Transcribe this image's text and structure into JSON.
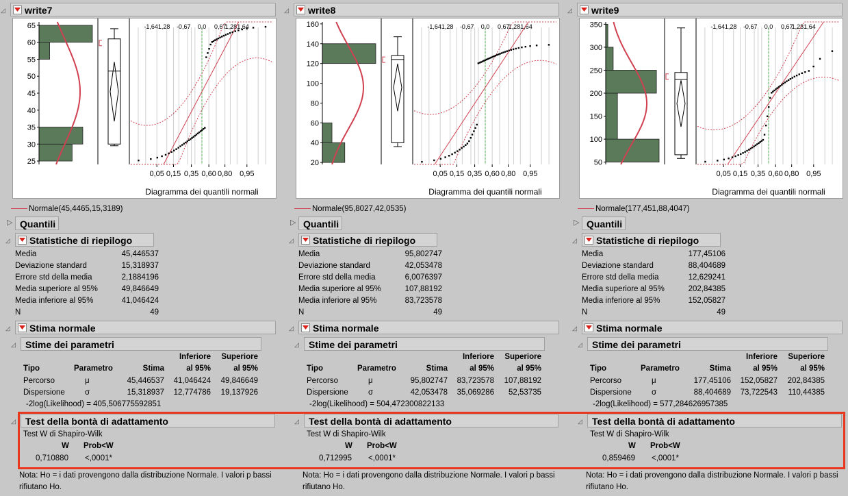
{
  "colors": {
    "accent_red": "#e8371e",
    "bar_green": "#5a7a5a",
    "curve_red": "#d04050",
    "ref_green": "#4fb04f"
  },
  "icons": {
    "dropdown": "red-down-triangle-icon",
    "disclosure": "disclosure-triangle-icon"
  },
  "common": {
    "plot_xlabel": "Diagramma dei quantili normali",
    "top_ticks": [
      "-1,641,28",
      "-0,67",
      "0,0",
      "0,67",
      "1,281,64"
    ],
    "bottom_ticks": [
      "0,05",
      "0,15",
      "0,35",
      "0,60",
      "0,80",
      "0,95"
    ],
    "quantiles_title": "Quantili",
    "summary_title": "Statistiche di riepilogo",
    "summary_labels": [
      "Media",
      "Deviazione standard",
      "Errore std della media",
      "Media superiore al 95%",
      "Media inferiore al 95%",
      "N"
    ],
    "fit_title": "Stima normale",
    "params_title": "Stime dei parametri",
    "param_headers": {
      "tipo": "Tipo",
      "parametro": "Parametro",
      "stima": "Stima",
      "inf1": "Inferiore",
      "inf2": "al 95%",
      "sup1": "Superiore",
      "sup2": "al 95%"
    },
    "param_types": [
      "Percorso",
      "Dispersione"
    ],
    "param_symbols": [
      "μ",
      "σ"
    ],
    "gof_title": "Test della bontà di adattamento",
    "gof_test": "Test W di Shapiro-Wilk",
    "gof_w_header": "W",
    "gof_p_header": "Prob<W",
    "note": "Nota: Ho = i dati provengono dalla distribuzione Normale. I valori p bassi rifiutano Ho."
  },
  "columns": [
    {
      "title": "write7",
      "y_ticks": [
        "65",
        "60",
        "55",
        "50",
        "45",
        "40",
        "35",
        "30",
        "25"
      ],
      "y_min": 24,
      "y_max": 66,
      "bins": [
        {
          "lo": 25,
          "hi": 30,
          "f": 0.62
        },
        {
          "lo": 30,
          "hi": 35,
          "f": 0.82
        },
        {
          "lo": 55,
          "hi": 60,
          "f": 0.2
        },
        {
          "lo": 60,
          "hi": 65,
          "f": 1.0
        }
      ],
      "mean": 45.4465,
      "sd": 15.3189,
      "box": {
        "min": 29.5,
        "q1": 30,
        "median": 51.5,
        "q3": 61,
        "max": 64
      },
      "legend": "Normale(45,4465,15,3189)",
      "summary": [
        "45,446537",
        "15,318937",
        "2,1884196",
        "49,846649",
        "41,046424",
        "49"
      ],
      "params": [
        [
          "45,446537",
          "41,046424",
          "49,846649"
        ],
        [
          "15,318937",
          "12,774786",
          "19,137926"
        ]
      ],
      "loglik": "-2log(Likelihood) = 405,50677559285​1",
      "w": "0,710880",
      "p": "<,0001*"
    },
    {
      "title": "write8",
      "y_ticks": [
        "160",
        "140",
        "120",
        "100",
        "80",
        "60",
        "40",
        "20"
      ],
      "y_min": 18,
      "y_max": 162,
      "bins": [
        {
          "lo": 20,
          "hi": 40,
          "f": 0.42
        },
        {
          "lo": 40,
          "hi": 60,
          "f": 0.18
        },
        {
          "lo": 120,
          "hi": 140,
          "f": 1.0
        }
      ],
      "mean": 95.8027,
      "sd": 42.0535,
      "box": {
        "min": 36,
        "q1": 40,
        "median": 124,
        "q3": 128,
        "max": 147
      },
      "legend": "Normale(95,8027,42,0535)",
      "summary": [
        "95,802747",
        "42,053478",
        "6,0076397",
        "107,88192",
        "83,723578",
        "49"
      ],
      "params": [
        [
          "95,802747",
          "83,723578",
          "107,88192"
        ],
        [
          "42,053478",
          "35,069286",
          "52,53735"
        ]
      ],
      "loglik": "-2log(Likelihood) = 504,472300822133",
      "w": "0,712995",
      "p": "<,0001*"
    },
    {
      "title": "write9",
      "y_ticks": [
        "350",
        "300",
        "250",
        "200",
        "150",
        "100",
        "50"
      ],
      "y_min": 45,
      "y_max": 355,
      "bins": [
        {
          "lo": 50,
          "hi": 100,
          "f": 1.0
        },
        {
          "lo": 100,
          "hi": 200,
          "f": 0.22
        },
        {
          "lo": 200,
          "hi": 250,
          "f": 0.95
        },
        {
          "lo": 250,
          "hi": 300,
          "f": 0.14
        },
        {
          "lo": 300,
          "hi": 350,
          "f": 0.04
        }
      ],
      "mean": 177.451,
      "sd": 88.4047,
      "box": {
        "min": 58,
        "q1": 66,
        "median": 230,
        "q3": 245,
        "max": 342
      },
      "legend": "Normale(177,451,88,4047)",
      "summary": [
        "177,45106",
        "88,404689",
        "12,629241",
        "202,84385",
        "152,05827",
        "49"
      ],
      "params": [
        [
          "177,45106",
          "152,05827",
          "202,84385"
        ],
        [
          "88,404689",
          "73,722543",
          "110,44385"
        ]
      ],
      "loglik": "-2log(Likelihood) = 577,284626957385",
      "w": "0,859469",
      "p": "<,0001*"
    }
  ]
}
